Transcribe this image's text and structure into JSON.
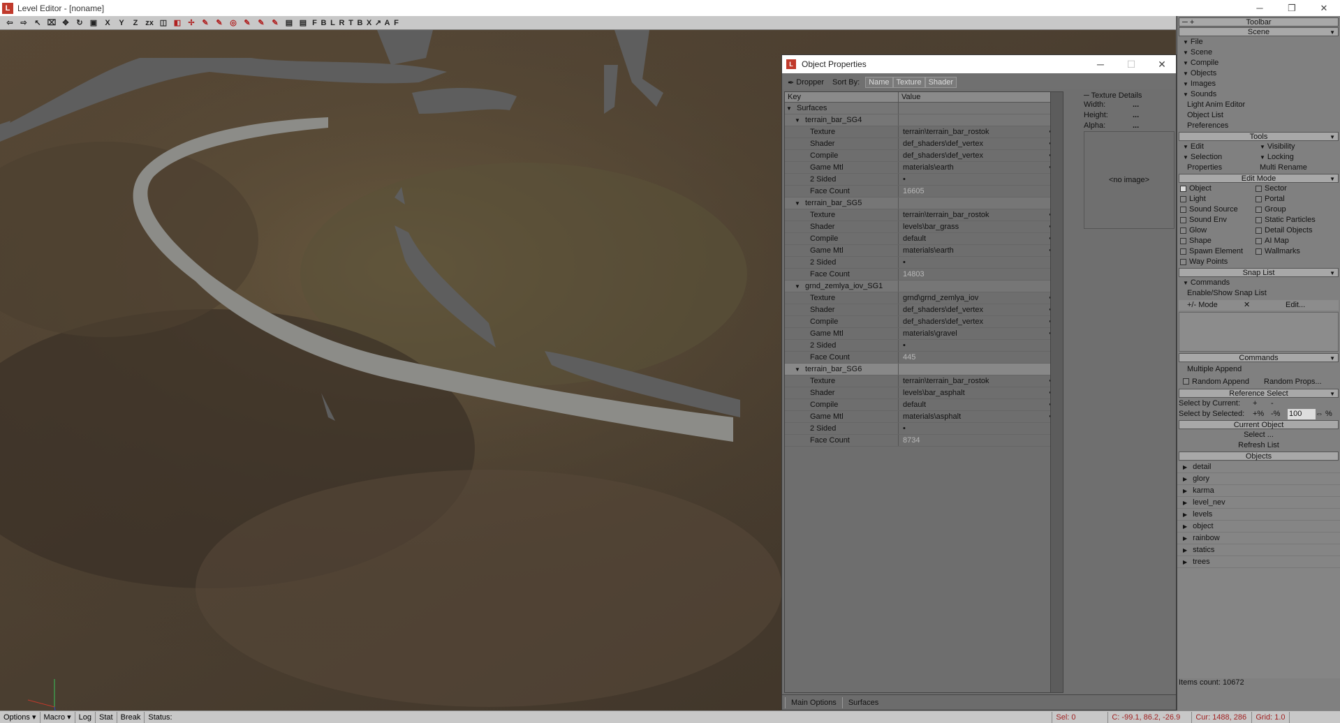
{
  "window": {
    "title": "Level Editor - [noname]",
    "min_icon": "minimize-icon",
    "max_icon": "restore-icon",
    "close_icon": "close-icon",
    "min": "─",
    "max": "❐",
    "close": "✕"
  },
  "toolbar": {
    "buttons": [
      "⇦",
      "⇨",
      "↖",
      "⌧",
      "✥",
      "↻",
      "▣",
      "X",
      "Y",
      "Z",
      "zx",
      "◫",
      "◧",
      "✢",
      "✎",
      "✎",
      "◎",
      "✎",
      "✎",
      "✎",
      "▤",
      "▤",
      "F",
      "B",
      "L",
      "R",
      "T",
      "B",
      "X",
      "↗",
      "A",
      "F"
    ]
  },
  "dialog": {
    "title": "Object Properties",
    "min": "─",
    "max": "☐",
    "close": "✕",
    "dropper": "Dropper",
    "sort_by": "Sort By:",
    "sort_buttons": [
      "Name",
      "Texture",
      "Shader"
    ],
    "columns": {
      "key": "Key",
      "value": "Value"
    },
    "root": "Surfaces",
    "surfaces": [
      {
        "name": "terrain_bar_SG4",
        "props": [
          {
            "k": "Texture",
            "v": "terrain\\terrain_bar_rostok",
            "dots": "•••"
          },
          {
            "k": "Shader",
            "v": "def_shaders\\def_vertex",
            "dots": "•••"
          },
          {
            "k": "Compile",
            "v": "def_shaders\\def_vertex",
            "dots": "•••"
          },
          {
            "k": "Game Mtl",
            "v": "materials\\earth",
            "dots": "•••"
          },
          {
            "k": "2 Sided",
            "v": "•",
            "dots": ""
          },
          {
            "k": "Face Count",
            "v": "16605",
            "dots": "",
            "dim": true
          }
        ]
      },
      {
        "name": "terrain_bar_SG5",
        "props": [
          {
            "k": "Texture",
            "v": "terrain\\terrain_bar_rostok",
            "dots": "•••"
          },
          {
            "k": "Shader",
            "v": "levels\\bar_grass",
            "dots": "•••"
          },
          {
            "k": "Compile",
            "v": "default",
            "dots": "•••"
          },
          {
            "k": "Game Mtl",
            "v": "materials\\earth",
            "dots": "•••"
          },
          {
            "k": "2 Sided",
            "v": "•",
            "dots": ""
          },
          {
            "k": "Face Count",
            "v": "14803",
            "dots": "",
            "dim": true
          }
        ]
      },
      {
        "name": "grnd_zemlya_iov_SG1",
        "props": [
          {
            "k": "Texture",
            "v": "grnd\\grnd_zemlya_iov",
            "dots": "•••"
          },
          {
            "k": "Shader",
            "v": "def_shaders\\def_vertex",
            "dots": "•••"
          },
          {
            "k": "Compile",
            "v": "def_shaders\\def_vertex",
            "dots": "•••"
          },
          {
            "k": "Game Mtl",
            "v": "materials\\gravel",
            "dots": "•••"
          },
          {
            "k": "2 Sided",
            "v": "•",
            "dots": ""
          },
          {
            "k": "Face Count",
            "v": "445",
            "dots": "",
            "dim": true
          }
        ]
      },
      {
        "name": "terrain_bar_SG6",
        "props": [
          {
            "k": "Texture",
            "v": "terrain\\terrain_bar_rostok",
            "dots": "•••"
          },
          {
            "k": "Shader",
            "v": "levels\\bar_asphalt",
            "dots": "•••"
          },
          {
            "k": "Compile",
            "v": "default",
            "dots": "•••"
          },
          {
            "k": "Game Mtl",
            "v": "materials\\asphalt",
            "dots": "•••"
          },
          {
            "k": "2 Sided",
            "v": "•",
            "dots": ""
          },
          {
            "k": "Face Count",
            "v": "8734",
            "dots": "",
            "dim": true
          }
        ]
      }
    ],
    "texture_details": {
      "legend": "Texture Details",
      "width_label": "Width:",
      "width_value": "...",
      "height_label": "Height:",
      "height_value": "...",
      "alpha_label": "Alpha:",
      "alpha_value": "...",
      "no_image": "<no image>"
    },
    "tabs": [
      "Main Options",
      "Surfaces"
    ]
  },
  "panel": {
    "toolbar_title": "Toolbar",
    "scene_title": "Scene",
    "scene_items": [
      "File",
      "Scene",
      "Compile",
      "Objects",
      "Images",
      "Sounds"
    ],
    "scene_plain": [
      "Light Anim Editor",
      "Object List",
      "Preferences"
    ],
    "tools_title": "Tools",
    "tools": {
      "edit": "Edit",
      "visibility": "Visibility",
      "selection": "Selection",
      "locking": "Locking",
      "properties": "Properties",
      "multi_rename": "Multi Rename"
    },
    "edit_mode_title": "Edit Mode",
    "edit_modes_left": [
      "Object",
      "Light",
      "Sound Source",
      "Sound Env",
      "Glow",
      "Shape",
      "Spawn Element",
      "Way Points"
    ],
    "edit_modes_right": [
      "Sector",
      "Portal",
      "Group",
      "Static Particles",
      "Detail Objects",
      "AI Map",
      "Wallmarks"
    ],
    "snap_title": "Snap List",
    "snap_commands": "Commands",
    "snap_enable": "Enable/Show Snap List",
    "snap_mode": "+/- Mode",
    "snap_x": "✕",
    "snap_edit": "Edit...",
    "commands_title": "Commands",
    "multiple_append": "Multiple Append",
    "random_append": "Random Append",
    "random_props": "Random Props...",
    "ref_select_title": "Reference Select",
    "select_by_current": "Select by Current:",
    "sbc_plus": "+",
    "sbc_minus": "-",
    "select_by_selected": "Select by Selected:",
    "sbs_plus": "+%",
    "sbs_minus": "-%",
    "sbs_value": "100",
    "sbs_pct": "%",
    "current_object_title": "Current Object",
    "select_btn": "Select ...",
    "refresh_btn": "Refresh List",
    "objects_title": "Objects",
    "objects": [
      "detail",
      "glory",
      "karma",
      "level_nev",
      "levels",
      "object",
      "rainbow",
      "statics",
      "trees"
    ],
    "items_count": "Items count: 10672"
  },
  "status": {
    "options": "Options",
    "macro": "Macro",
    "log": "Log",
    "stat": "Stat",
    "break": "Break",
    "status": "Status:",
    "sel": "Sel: 0",
    "coords": "C: -99.1, 86.2, -26.9",
    "cur": "Cur: 1488, 286",
    "grid": "Grid: 1.0"
  },
  "colors": {
    "accent_red": "#c0392b",
    "road": "#8c8c88",
    "water": "#5e5e5e"
  }
}
